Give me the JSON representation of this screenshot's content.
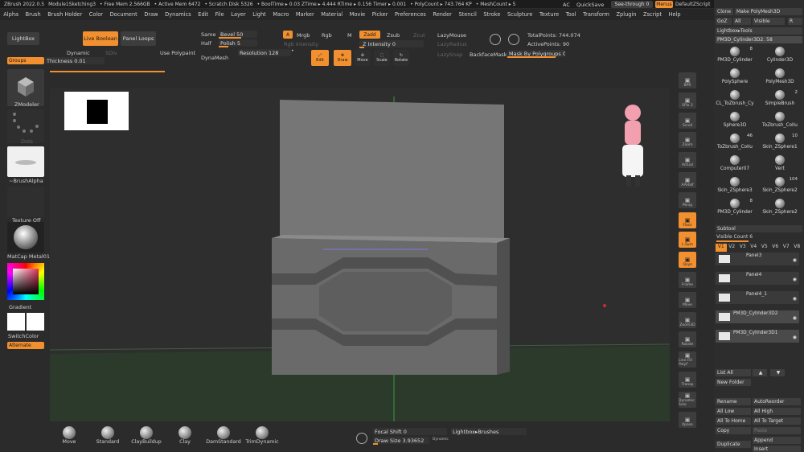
{
  "titlebar": {
    "app": "ZBrush 2022.0.5",
    "file": "Module1Sketching3",
    "free_mem": "• Free Mem 2.566GB",
    "active_mem": "• Active Mem 6472",
    "scratch": "• Scratch Disk 5326",
    "booltime": "• BoolTime ▸ 0.03 ZTime ▸ 4.444 RTime ▸ 0.156 Timer ▸ 0.001",
    "polycount": "• PolyCount ▸ 743.764 KP",
    "meshcount": "• MeshCount ▸ 5"
  },
  "top_right": {
    "ac": "AC",
    "quicksave": "QuickSave",
    "seethrough": "See-through  0",
    "menus": "Menus",
    "defaultzscript": "DefaultZScript"
  },
  "menu": [
    "Alpha",
    "Brush",
    "Brush Holder",
    "Color",
    "Document",
    "Draw",
    "Dynamics",
    "Edit",
    "File",
    "Layer",
    "Light",
    "Macro",
    "Marker",
    "Material",
    "Movie",
    "Picker",
    "Preferences",
    "Render",
    "Stencil",
    "Stroke",
    "Sculpture",
    "Texture",
    "Tool",
    "Transform",
    "Zplugin",
    "Zscript",
    "Help"
  ],
  "toolbar": {
    "lightbox": "LightBox",
    "live_boolean": "Live Boolean",
    "panel_loops": "Panel Loops",
    "same": "Same",
    "half": "Half",
    "bevel": "Bevel 50",
    "polish": "Polish 5",
    "dynamic": "Dynamic",
    "sdiv": "SDiv",
    "use_polypaint": "Use Polypaint",
    "dynamesh": "DynaMesh",
    "resolution": "Resolution 128",
    "groups": "Groups",
    "thickness": "Thickness 0.01",
    "a": "A",
    "mrgb": "Mrgb",
    "rgb": "Rgb",
    "m": "M",
    "zadd": "Zadd",
    "zsub": "Zsub",
    "zcut": "Zcut",
    "rgb_intensity": "Rgb Intensity",
    "z_intensity": "Z Intensity 0",
    "lazymouse": "LazyMouse",
    "lazyradius": "LazyRadius",
    "lazysnap": "LazySnap",
    "backfacemask": "BackfaceMask",
    "mask_by_polygroups": "Mask By Polygroups 0",
    "totalpoints": "TotalPoints: 744.074",
    "activepoints": "ActivePoints: 90",
    "edit": "Edit",
    "draw": "Draw",
    "move": "Move",
    "scale": "Scale",
    "rotate": "Rotate"
  },
  "left": {
    "zmodeler": "ZModeler",
    "dots": "Dots",
    "brushalpha": "~BrushAlpha",
    "texture_off": "Texture Off",
    "matcap": "MatCap Metal01",
    "gradient": "Gradient",
    "switchcolor": "SwitchColor",
    "alternate": "Alternate"
  },
  "right_tools": [
    "BPR",
    "SPix 2",
    "Scroll",
    "Zoom",
    "Actual",
    "AAHalf",
    "Persp",
    "Floor",
    "L.Sym",
    "Qxyz",
    "Frame",
    "Move",
    "Zoom3D",
    "Rotate",
    "Line Fill PolyF",
    "Transp",
    "Dynamic Solo",
    "Xpose"
  ],
  "tool_panel": {
    "clone": "Clone",
    "make_polymesh": "Make PolyMesh3D",
    "goz": "GoZ",
    "all": "All",
    "visible": "Visible",
    "r": "R",
    "lightbox_tools": "Lightbox▸Tools",
    "current": "PM3D_Cylinder3D2. 58",
    "tools": [
      {
        "name": "PM3D_Cylinder",
        "count": "8"
      },
      {
        "name": "Cylinder3D",
        "count": ""
      },
      {
        "name": "PolySphere",
        "count": ""
      },
      {
        "name": "PolyMesh3D",
        "count": ""
      },
      {
        "name": "CL_ToZbrush_Cy",
        "count": ""
      },
      {
        "name": "SimpleBrush",
        "count": "2"
      },
      {
        "name": "Sphere3D",
        "count": ""
      },
      {
        "name": "ToZbrush_Collu",
        "count": ""
      },
      {
        "name": "ToZbrush_Collu",
        "count": "46"
      },
      {
        "name": "Skin_ZSphere1",
        "count": "10"
      },
      {
        "name": "Computer07",
        "count": ""
      },
      {
        "name": "Vert",
        "count": ""
      },
      {
        "name": "Skin_ZSphere3",
        "count": ""
      },
      {
        "name": "Skin_ZSphere2",
        "count": "104"
      },
      {
        "name": "PM3D_Cylinder",
        "count": "8"
      },
      {
        "name": "Skin_ZSphere2",
        "count": ""
      }
    ],
    "subtool": "Subtool",
    "visible_count": "Visible Count 6",
    "versions": [
      "V1",
      "V2",
      "V3",
      "V4",
      "V5",
      "V6",
      "V7",
      "V8"
    ],
    "subtools": [
      "Panel3",
      "Panel4",
      "Panel4_1",
      "PM3D_Cylinder3D2",
      "PM3D_Cylinder3D1"
    ],
    "list_all": "List All",
    "new_folder": "New Folder",
    "rename": "Rename",
    "autoreorder": "AutoReorder",
    "all_low": "All Low",
    "all_high": "All High",
    "all_to_home": "All To Home",
    "all_to_target": "All To Target",
    "copy": "Copy",
    "paste": "Paste",
    "duplicate": "Duplicate",
    "append": "Append",
    "insert": "Insert"
  },
  "bottom": {
    "brushes": [
      "Move",
      "Standard",
      "ClayBuildup",
      "Clay",
      "DamStandard",
      "TrimDynamic"
    ],
    "focal_shift": "Focal Shift 0",
    "draw_size": "Draw Size 3.93652",
    "dynamic": "Dynamic",
    "lightbox_brushes": "Lightbox▸Brushes"
  },
  "colors": {
    "accent": "#f28f2f",
    "panel": "#2b2b2b",
    "viewport": "#2e2e2e"
  }
}
